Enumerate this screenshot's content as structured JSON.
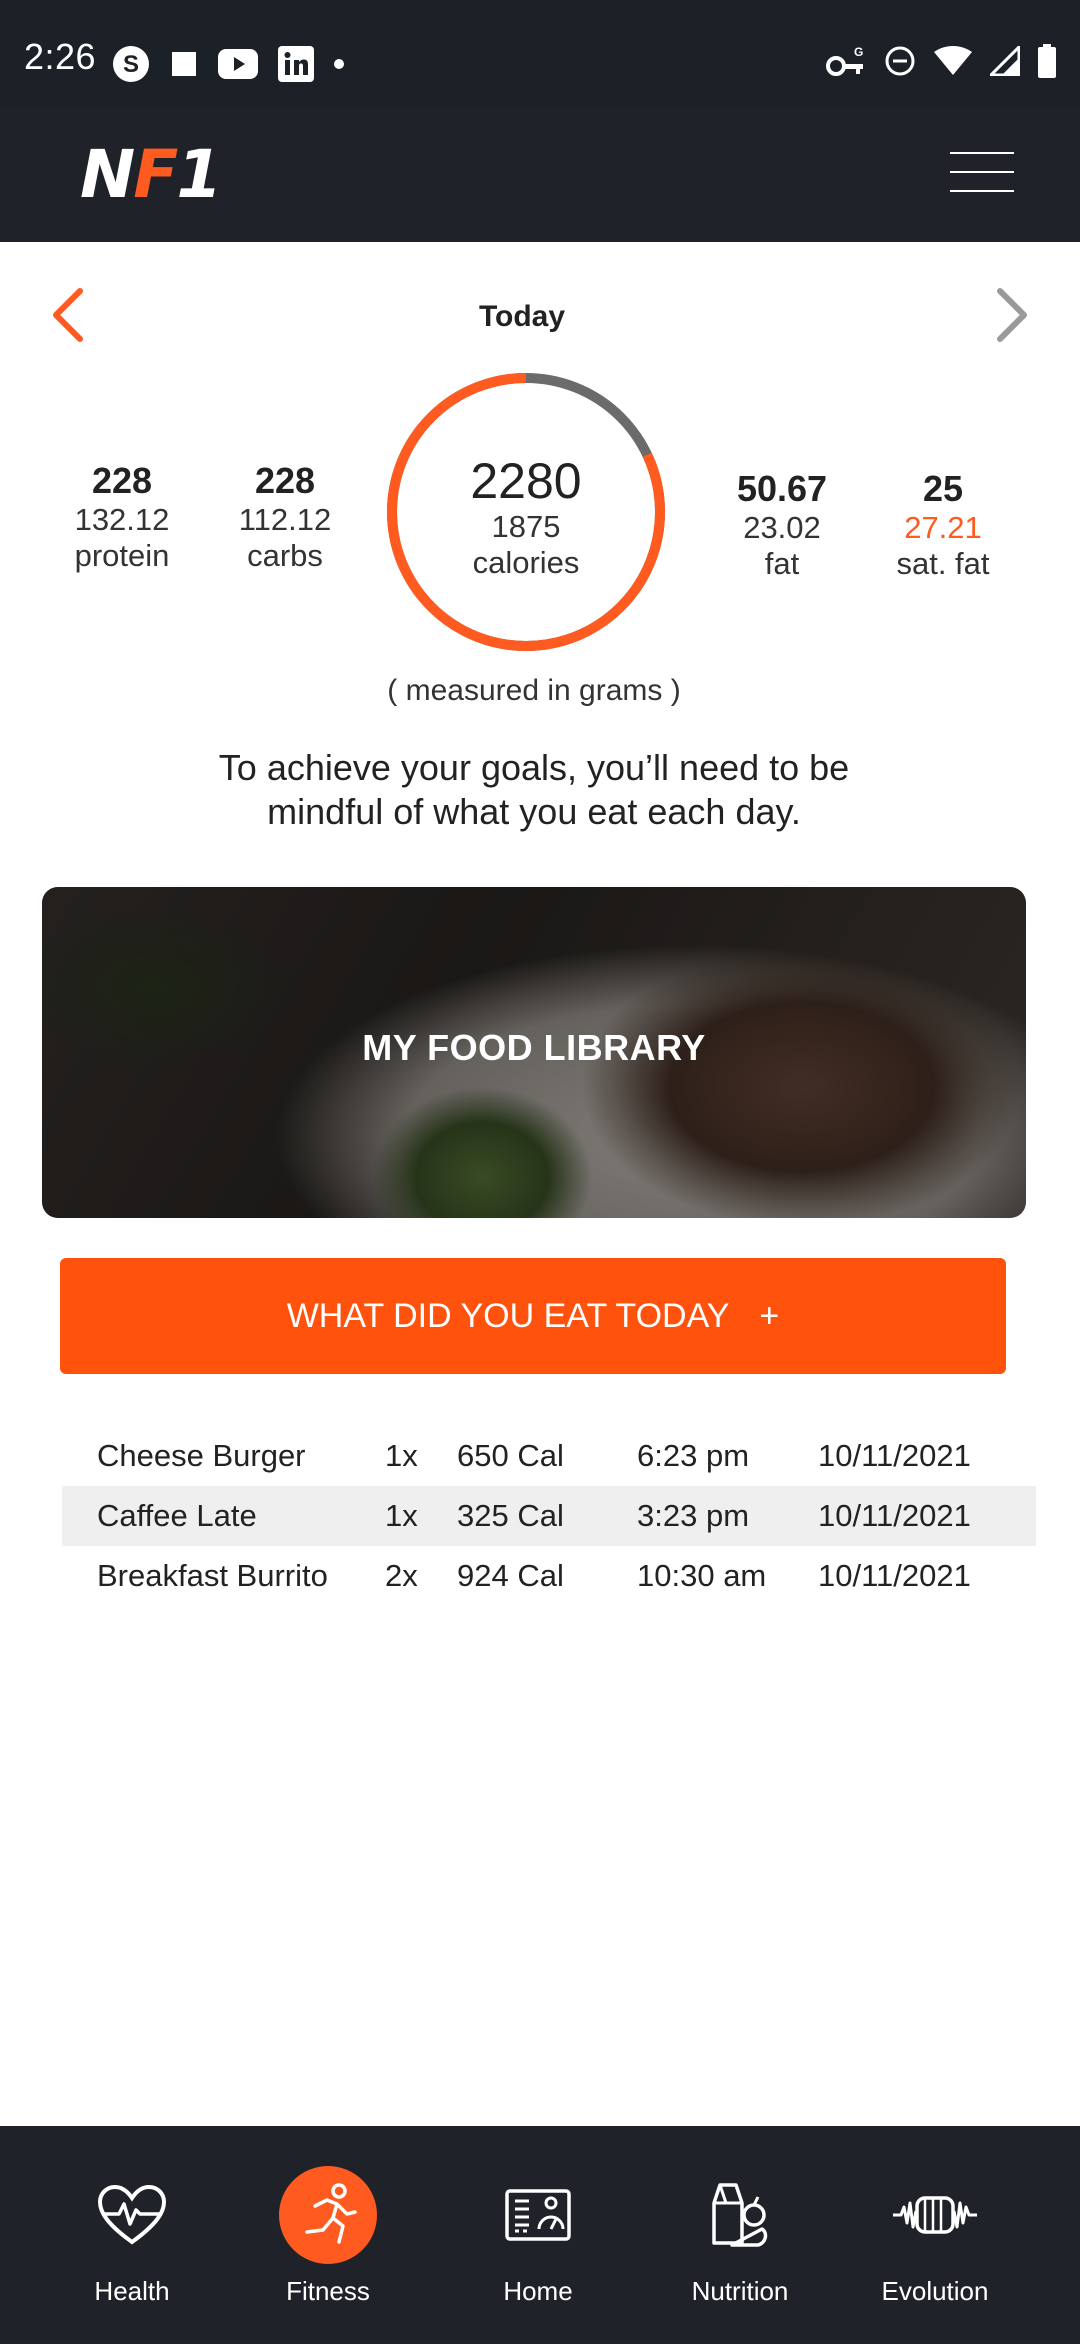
{
  "status_bar": {
    "time": "2:26"
  },
  "header": {
    "logo_prefix": "N",
    "logo_accent": "F",
    "logo_suffix": "1"
  },
  "date_nav": {
    "title": "Today"
  },
  "macros": {
    "protein": {
      "goal": "228",
      "value": "132.12",
      "label": "protein"
    },
    "carbs": {
      "goal": "228",
      "value": "112.12",
      "label": "carbs"
    },
    "calories": {
      "goal": "2280",
      "value": "1875",
      "label": "calories",
      "progress": 0.82
    },
    "fat": {
      "goal": "50.67",
      "value": "23.02",
      "label": "fat"
    },
    "sat_fat": {
      "goal": "25",
      "value": "27.21",
      "label": "sat. fat"
    }
  },
  "measured_note": "( measured in grams )",
  "advice": "To achieve your goals, you’ll need to be mindful of what you eat each day.",
  "library": {
    "title": "MY FOOD LIBRARY"
  },
  "cta": {
    "label": "WHAT DID YOU EAT TODAY",
    "plus": "+"
  },
  "food_log": [
    {
      "name": "Cheese Burger",
      "qty": "1x",
      "cal": "650 Cal",
      "time": "6:23 pm",
      "date": "10/11/2021"
    },
    {
      "name": "Caffee Late",
      "qty": "1x",
      "cal": "325 Cal",
      "time": "3:23 pm",
      "date": "10/11/2021"
    },
    {
      "name": "Breakfast Burrito",
      "qty": "2x",
      "cal": "924 Cal",
      "time": "10:30 am",
      "date": "10/11/2021"
    }
  ],
  "bottom_nav": [
    {
      "label": "Health",
      "icon": "heart-pulse-icon",
      "active": false
    },
    {
      "label": "Fitness",
      "icon": "running-person-icon",
      "active": true
    },
    {
      "label": "Home",
      "icon": "dashboard-icon",
      "active": false
    },
    {
      "label": "Nutrition",
      "icon": "food-groceries-icon",
      "active": false
    },
    {
      "label": "Evolution",
      "icon": "waveform-icon",
      "active": false
    }
  ],
  "colors": {
    "accent": "#ff5a1f",
    "dark": "#1f2329",
    "ring_rest": "#6b6b6b",
    "row_alt": "#efefef"
  }
}
